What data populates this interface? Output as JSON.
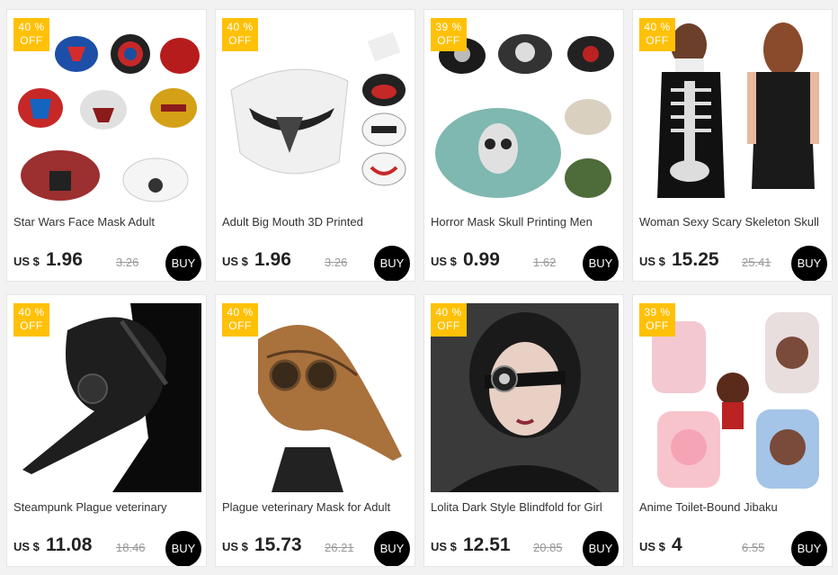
{
  "products": [
    {
      "badge_pct": "40 %",
      "badge_off": "OFF",
      "title": "Star Wars Face Mask  Adult",
      "currency": "US $",
      "price": "1.96",
      "old_price": "3.26",
      "buy": "BUY"
    },
    {
      "badge_pct": "40 %",
      "badge_off": "OFF",
      "title": "Adult Big Mouth 3D Printed",
      "currency": "US $",
      "price": "1.96",
      "old_price": "3.26",
      "buy": "BUY"
    },
    {
      "badge_pct": "39 %",
      "badge_off": "OFF",
      "title": "Horror Mask Skull Printing Men",
      "currency": "US $",
      "price": "0.99",
      "old_price": "1.62",
      "buy": "BUY"
    },
    {
      "badge_pct": "40 %",
      "badge_off": "OFF",
      "title": "Woman Sexy Scary Skeleton Skull",
      "currency": "US $",
      "price": "15.25",
      "old_price": "25.41",
      "buy": "BUY"
    },
    {
      "badge_pct": "40 %",
      "badge_off": "OFF",
      "title": "Steampunk Plague veterinary",
      "currency": "US $",
      "price": "11.08",
      "old_price": "18.46",
      "buy": "BUY"
    },
    {
      "badge_pct": "40 %",
      "badge_off": "OFF",
      "title": "Plague veterinary Mask for Adult",
      "currency": "US $",
      "price": "15.73",
      "old_price": "26.21",
      "buy": "BUY"
    },
    {
      "badge_pct": "40 %",
      "badge_off": "OFF",
      "title": "Lolita Dark Style Blindfold for Girl",
      "currency": "US $",
      "price": "12.51",
      "old_price": "20.85",
      "buy": "BUY"
    },
    {
      "badge_pct": "39 %",
      "badge_off": "OFF",
      "title": "Anime Toilet-Bound Jibaku",
      "currency": "US $",
      "price": "4",
      "old_price": "6.55",
      "buy": "BUY"
    }
  ],
  "colors": {
    "badge": "#ffc107",
    "buy_button": "#000000",
    "old_price": "#999999"
  }
}
